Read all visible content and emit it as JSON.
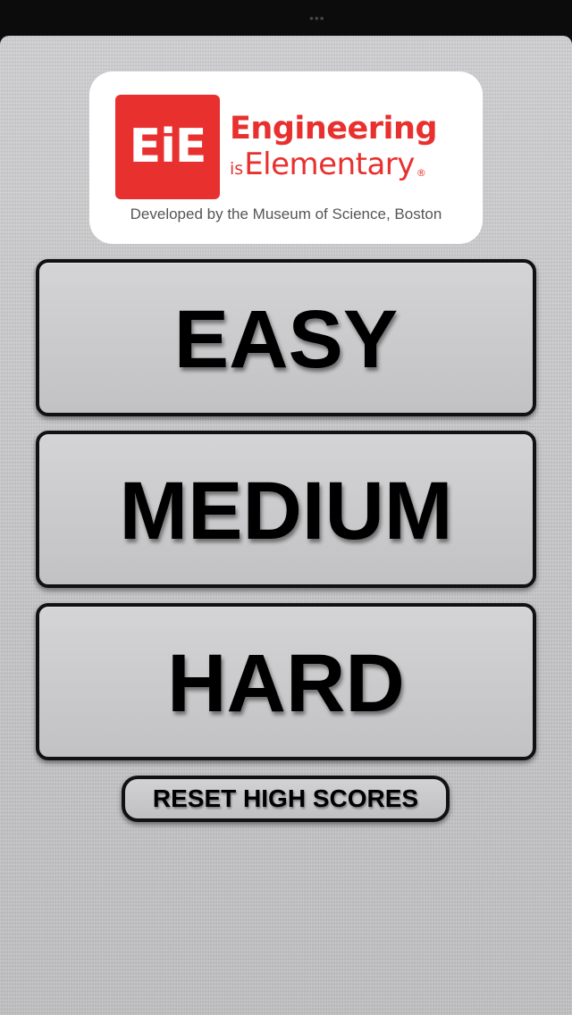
{
  "status_bar": {
    "indicator": "•••"
  },
  "logo": {
    "square_text": "EiE",
    "line1": "Engineering",
    "line2_prefix": "is",
    "line2_word": "Elementary",
    "registered_mark": "®",
    "developer_text": "Developed by the Museum of Science, Boston",
    "brand_color": "#e8312f"
  },
  "levels": [
    {
      "label": "EASY"
    },
    {
      "label": "MEDIUM"
    },
    {
      "label": "HARD"
    }
  ],
  "reset": {
    "label": "RESET HIGH SCORES"
  },
  "colors": {
    "background": "#c9c9cb",
    "button_border": "#111111",
    "button_text": "#000000"
  }
}
